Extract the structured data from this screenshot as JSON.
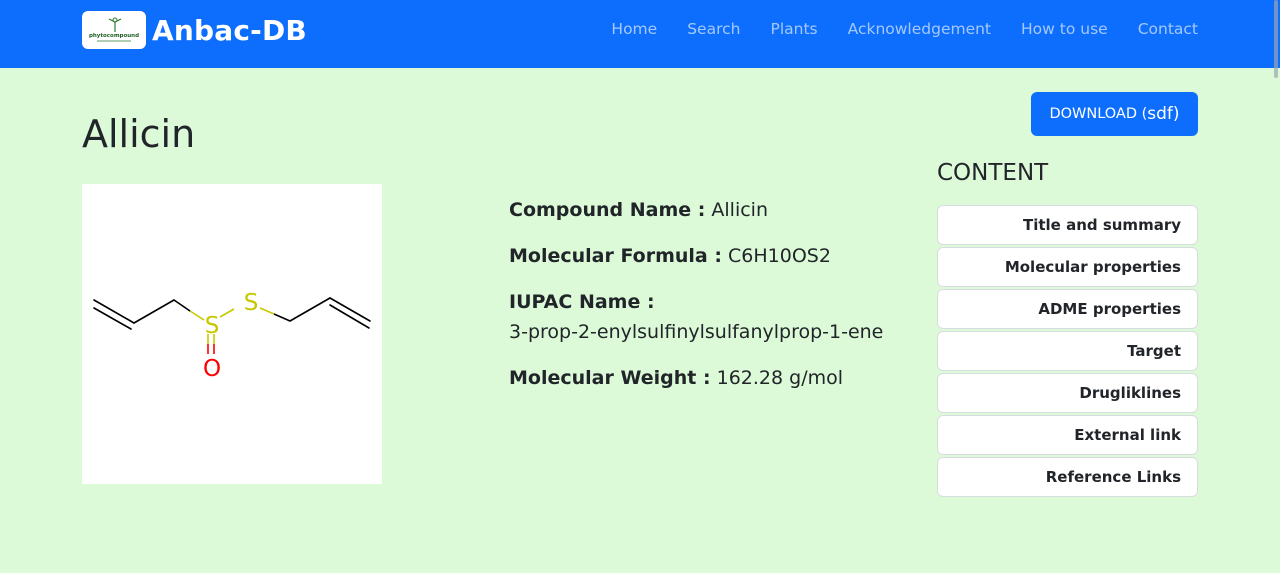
{
  "brand": {
    "name": "Anbac-DB",
    "logo_text": "phytocompound"
  },
  "nav": [
    {
      "label": "Home"
    },
    {
      "label": "Search"
    },
    {
      "label": "Plants"
    },
    {
      "label": "Acknowledgement"
    },
    {
      "label": "How to use"
    },
    {
      "label": "Contact"
    }
  ],
  "page": {
    "title": "Allicin",
    "download_main": "DOWNLOAD ( ",
    "download_ext": "sdf)"
  },
  "structure": {
    "atoms": [
      "S",
      "S",
      "O"
    ],
    "bond_color": "#000000",
    "sulfur_color": "#c8c800",
    "oxygen_color": "#ff0000"
  },
  "properties": [
    {
      "label": "Compound Name :",
      "value": "Allicin"
    },
    {
      "label": "Molecular Formula :",
      "value": "C6H10OS2"
    },
    {
      "label": "IUPAC Name :",
      "value": "3-prop-2-enylsulfinylsulfanylprop-1-ene"
    },
    {
      "label": "Molecular Weight :",
      "value": "162.28 g/mol"
    }
  ],
  "content": {
    "heading": "CONTENT",
    "items": [
      {
        "label": "Title and summary"
      },
      {
        "label": "Molecular properties"
      },
      {
        "label": "ADME properties"
      },
      {
        "label": "Target"
      },
      {
        "label": "Drugliklines"
      },
      {
        "label": "External link"
      },
      {
        "label": "Reference Links"
      }
    ]
  },
  "colors": {
    "primary": "#0d6efd",
    "background": "#dcfad8"
  }
}
